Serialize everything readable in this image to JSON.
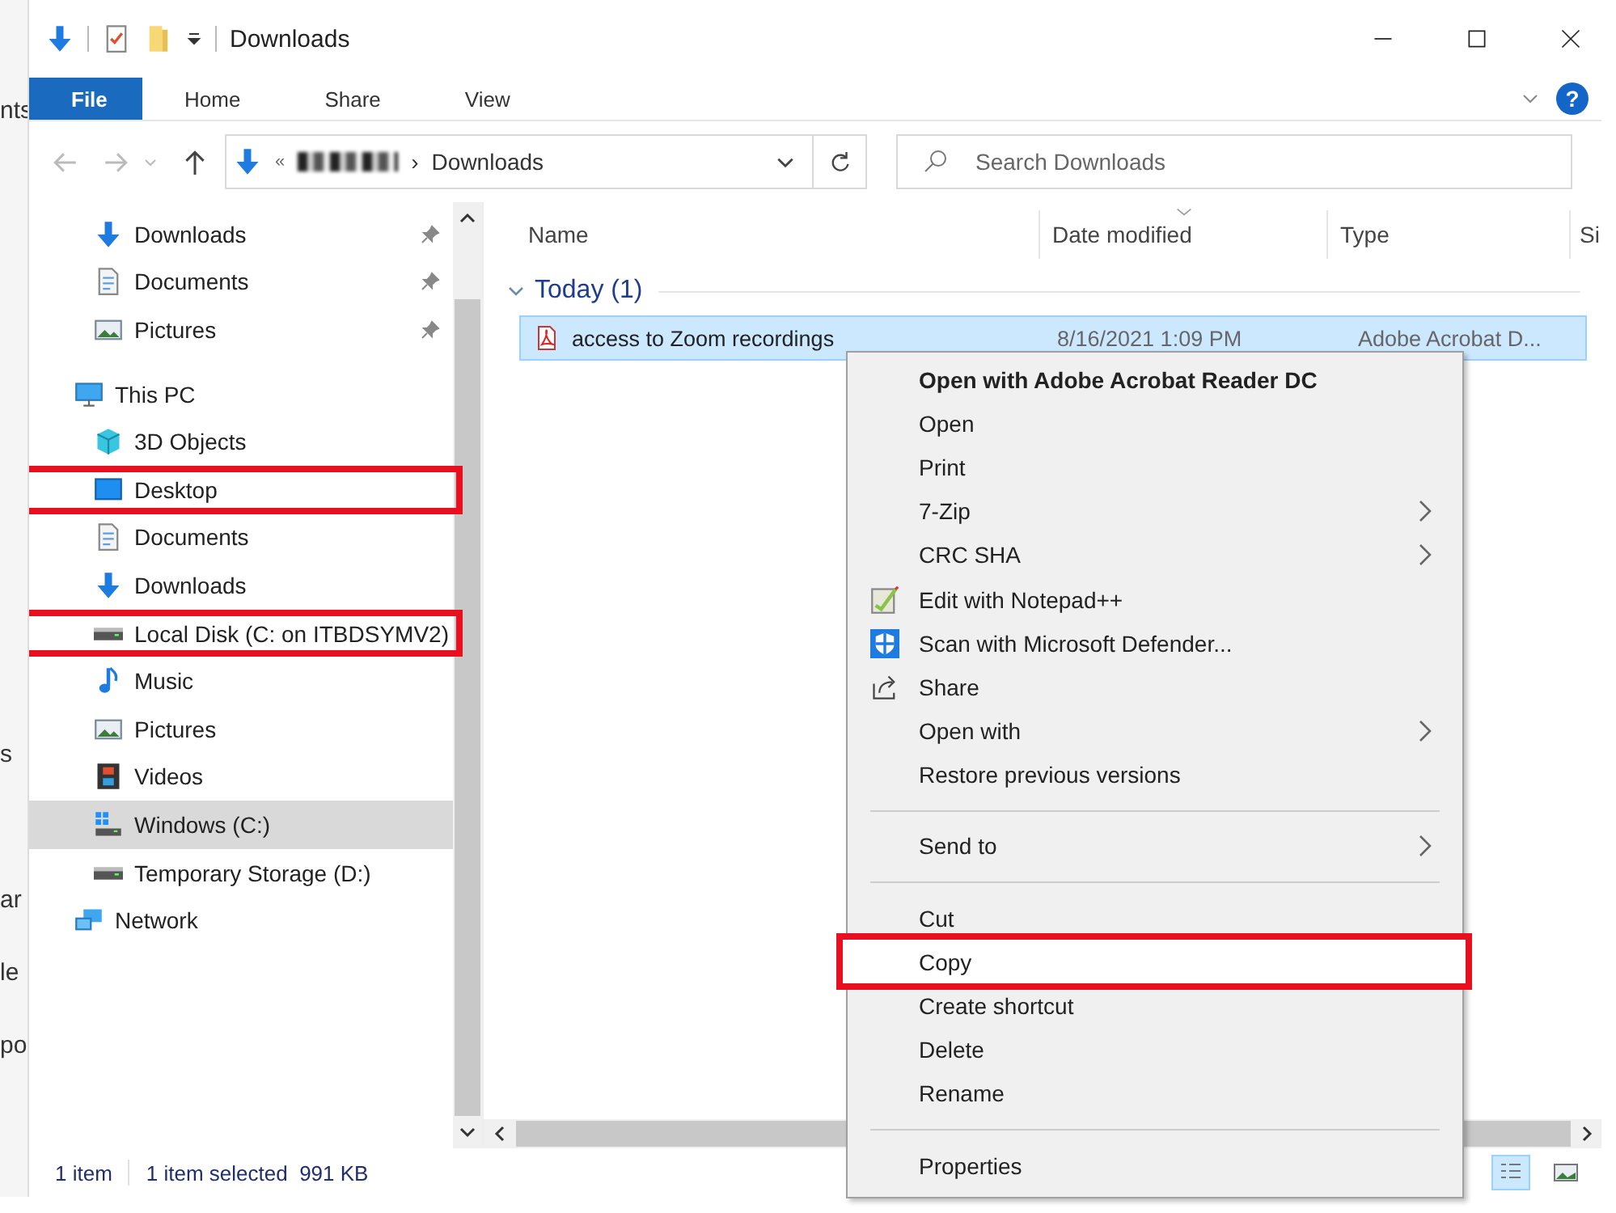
{
  "background_fragments": [
    "nts",
    "s",
    "ar",
    "le",
    "po"
  ],
  "window": {
    "title": "Downloads"
  },
  "ribbon": {
    "help": "?",
    "tabs": [
      {
        "label": "File",
        "selected": true
      },
      {
        "label": "Home",
        "selected": false
      },
      {
        "label": "Share",
        "selected": false
      },
      {
        "label": "View",
        "selected": false
      }
    ]
  },
  "address_bar": {
    "prefix": "«",
    "separator": "›",
    "current": "Downloads"
  },
  "search": {
    "placeholder": "Search Downloads"
  },
  "nav_pane": {
    "pinned": [
      {
        "label": "Downloads",
        "kind": "download",
        "pinned": true,
        "selected": false,
        "highlighted": false
      },
      {
        "label": "Documents",
        "kind": "document",
        "pinned": true,
        "selected": false,
        "highlighted": false
      },
      {
        "label": "Pictures",
        "kind": "picture",
        "pinned": true,
        "selected": false,
        "highlighted": false
      }
    ],
    "tree": [
      {
        "label": "This PC",
        "kind": "pc",
        "selected": false,
        "highlighted": false,
        "children": [
          {
            "label": "3D Objects",
            "kind": "cube",
            "selected": false,
            "highlighted": false
          },
          {
            "label": "Desktop",
            "kind": "desktop",
            "selected": false,
            "highlighted": true
          },
          {
            "label": "Documents",
            "kind": "document",
            "selected": false,
            "highlighted": false
          },
          {
            "label": "Downloads",
            "kind": "download",
            "selected": false,
            "highlighted": false
          },
          {
            "label": "Local Disk (C: on ITBDSYMV2)",
            "kind": "drive",
            "selected": false,
            "highlighted": true
          },
          {
            "label": "Music",
            "kind": "music",
            "selected": false,
            "highlighted": false
          },
          {
            "label": "Pictures",
            "kind": "picture",
            "selected": false,
            "highlighted": false
          },
          {
            "label": "Videos",
            "kind": "video",
            "selected": false,
            "highlighted": false
          },
          {
            "label": "Windows (C:)",
            "kind": "windrive",
            "selected": true,
            "highlighted": false
          },
          {
            "label": "Temporary Storage (D:)",
            "kind": "drive",
            "selected": false,
            "highlighted": false
          }
        ]
      },
      {
        "label": "Network",
        "kind": "network",
        "selected": false,
        "highlighted": false
      }
    ]
  },
  "table": {
    "columns": [
      "Name",
      "Date modified",
      "Type",
      "Si"
    ],
    "groups": [
      {
        "label": "Today (1)",
        "expanded": true,
        "rows": [
          {
            "name": "access to Zoom recordings",
            "date": "8/16/2021 1:09 PM",
            "type": "Adobe Acrobat D...",
            "selected": true
          }
        ]
      }
    ]
  },
  "context_menu": {
    "items": [
      {
        "kind": "item",
        "label": "Open with Adobe Acrobat Reader DC",
        "default": true,
        "submenu": false,
        "highlighted": false
      },
      {
        "kind": "item",
        "label": "Open",
        "default": false,
        "submenu": false,
        "highlighted": false
      },
      {
        "kind": "item",
        "label": "Print",
        "default": false,
        "submenu": false,
        "highlighted": false
      },
      {
        "kind": "item",
        "label": "7-Zip",
        "default": false,
        "submenu": true,
        "highlighted": false
      },
      {
        "kind": "item",
        "label": "CRC SHA",
        "default": false,
        "submenu": true,
        "highlighted": false
      },
      {
        "kind": "notepad",
        "label": "Edit with Notepad++",
        "default": false,
        "submenu": false,
        "highlighted": false
      },
      {
        "kind": "shield",
        "label": "Scan with Microsoft Defender...",
        "default": false,
        "submenu": false,
        "highlighted": false
      },
      {
        "kind": "share",
        "label": "Share",
        "default": false,
        "submenu": false,
        "highlighted": false
      },
      {
        "kind": "item",
        "label": "Open with",
        "default": false,
        "submenu": true,
        "highlighted": false
      },
      {
        "kind": "item",
        "label": "Restore previous versions",
        "default": false,
        "submenu": false,
        "highlighted": false
      },
      {
        "kind": "separator"
      },
      {
        "kind": "item",
        "label": "Send to",
        "default": false,
        "submenu": true,
        "highlighted": false
      },
      {
        "kind": "separator"
      },
      {
        "kind": "item",
        "label": "Cut",
        "default": false,
        "submenu": false,
        "highlighted": false
      },
      {
        "kind": "item",
        "label": "Copy",
        "default": false,
        "submenu": false,
        "highlighted": true
      },
      {
        "kind": "item",
        "label": "Create shortcut",
        "default": false,
        "submenu": false,
        "highlighted": false
      },
      {
        "kind": "item",
        "label": "Delete",
        "default": false,
        "submenu": false,
        "highlighted": false
      },
      {
        "kind": "item",
        "label": "Rename",
        "default": false,
        "submenu": false,
        "highlighted": false
      },
      {
        "kind": "separator"
      },
      {
        "kind": "item",
        "label": "Properties",
        "default": false,
        "submenu": false,
        "highlighted": false
      }
    ]
  },
  "status_bar": {
    "items": [
      "1 item",
      "1 item selected  991 KB"
    ],
    "views": [
      {
        "kind": "details",
        "selected": true
      },
      {
        "kind": "large-icons",
        "selected": false
      }
    ]
  }
}
